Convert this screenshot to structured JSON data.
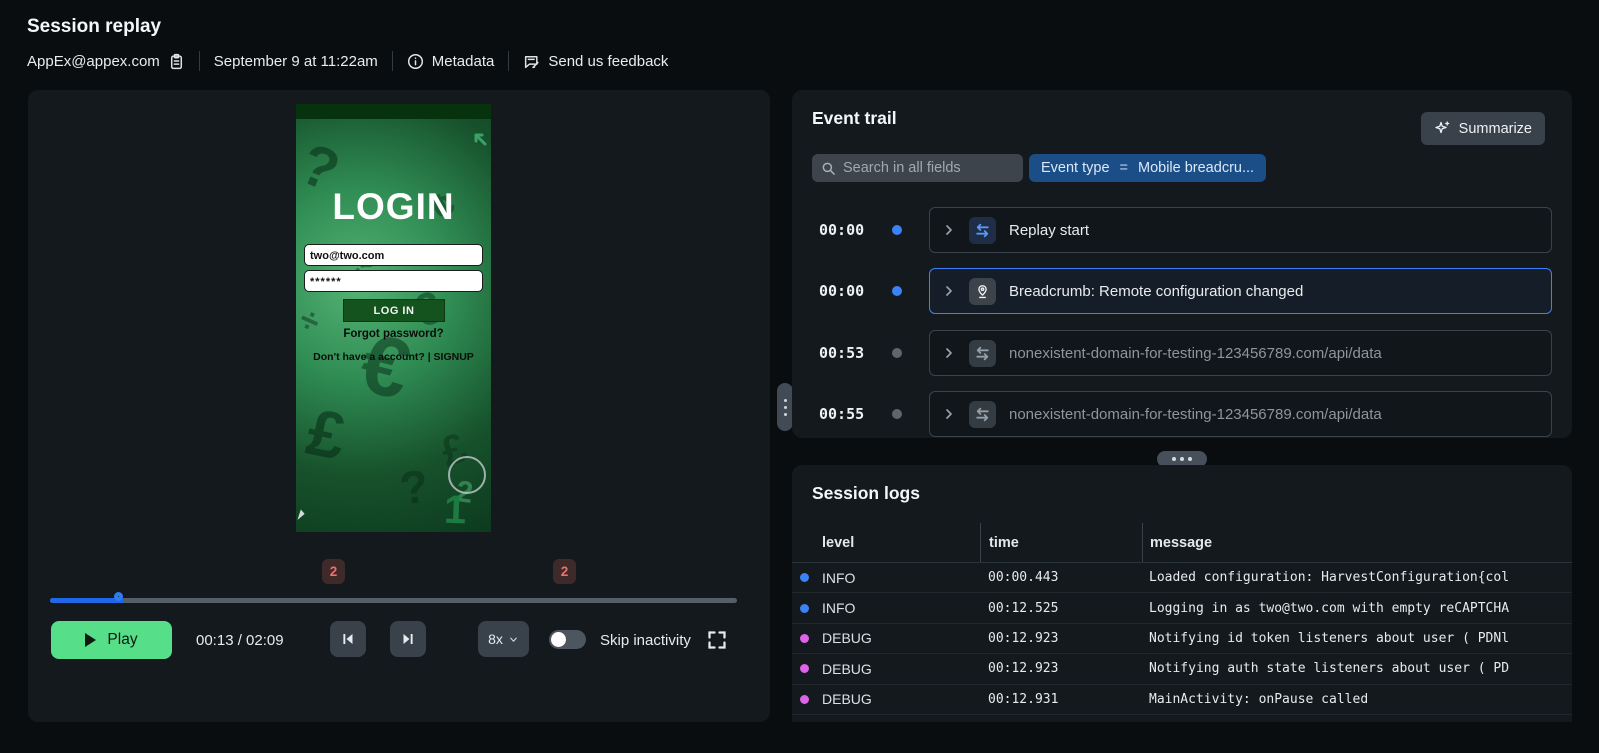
{
  "header": {
    "title": "Session replay",
    "replay_id": "AppEx@appex.com",
    "timestamp": "September 9 at 11:22am",
    "metadata_label": "Metadata",
    "feedback_label": "Send us feedback"
  },
  "player": {
    "phone": {
      "login_title": "LOGIN",
      "email_value": "two@two.com",
      "password_value": "******",
      "login_button": "LOG IN",
      "forgot_password": "Forgot password?",
      "signup_text": "Don't have a account? | SIGNUP",
      "bg_symbols": [
        "?",
        "€",
        "£",
        "¢",
        "?",
        "€",
        "£",
        "2",
        "?",
        "1",
        "÷"
      ]
    },
    "timeline": {
      "badges": [
        "2",
        "2"
      ],
      "progress_percent": 10.5
    },
    "controls": {
      "play_label": "Play",
      "time_display": "00:13 / 02:09",
      "speed": "8x",
      "skip_inactivity_label": "Skip inactivity",
      "skip_inactivity_on": false
    }
  },
  "event_trail": {
    "title": "Event trail",
    "summarize_label": "Summarize",
    "search_placeholder": "Search in all fields",
    "filter_chip": {
      "key": "Event type",
      "op": "=",
      "value": "Mobile breadcru..."
    },
    "events": [
      {
        "time": "00:00",
        "label": "Replay start",
        "icon": "swap-arrows-icon",
        "state": "active"
      },
      {
        "time": "00:00",
        "label": "Breadcrumb: Remote configuration changed",
        "icon": "location-pin-icon",
        "state": "selected"
      },
      {
        "time": "00:53",
        "label": "nonexistent-domain-for-testing-123456789.com/api/data",
        "icon": "swap-arrows-icon",
        "state": "muted"
      },
      {
        "time": "00:55",
        "label": "nonexistent-domain-for-testing-123456789.com/api/data",
        "icon": "swap-arrows-icon",
        "state": "muted"
      }
    ]
  },
  "session_logs": {
    "title": "Session logs",
    "columns": {
      "level": "level",
      "time": "time",
      "message": "message"
    },
    "rows": [
      {
        "level": "INFO",
        "time": "00:00.443",
        "message": "Loaded configuration: HarvestConfiguration{col"
      },
      {
        "level": "INFO",
        "time": "00:12.525",
        "message": "Logging in as two@two.com with empty reCAPTCHA"
      },
      {
        "level": "DEBUG",
        "time": "00:12.923",
        "message": "Notifying id token listeners about user ( PDNl"
      },
      {
        "level": "DEBUG",
        "time": "00:12.923",
        "message": "Notifying auth state listeners about user ( PD"
      },
      {
        "level": "DEBUG",
        "time": "00:12.931",
        "message": "MainActivity: onPause called"
      }
    ]
  },
  "colors": {
    "accent_blue": "#3b82f6",
    "chip_blue": "#1b4d87",
    "play_green": "#57de89",
    "info_dot": "#3b82f6",
    "debug_dot": "#df63e8",
    "badge_red": "#ee7070",
    "panel_bg": "#14191d",
    "page_bg": "#0a0d0f"
  }
}
